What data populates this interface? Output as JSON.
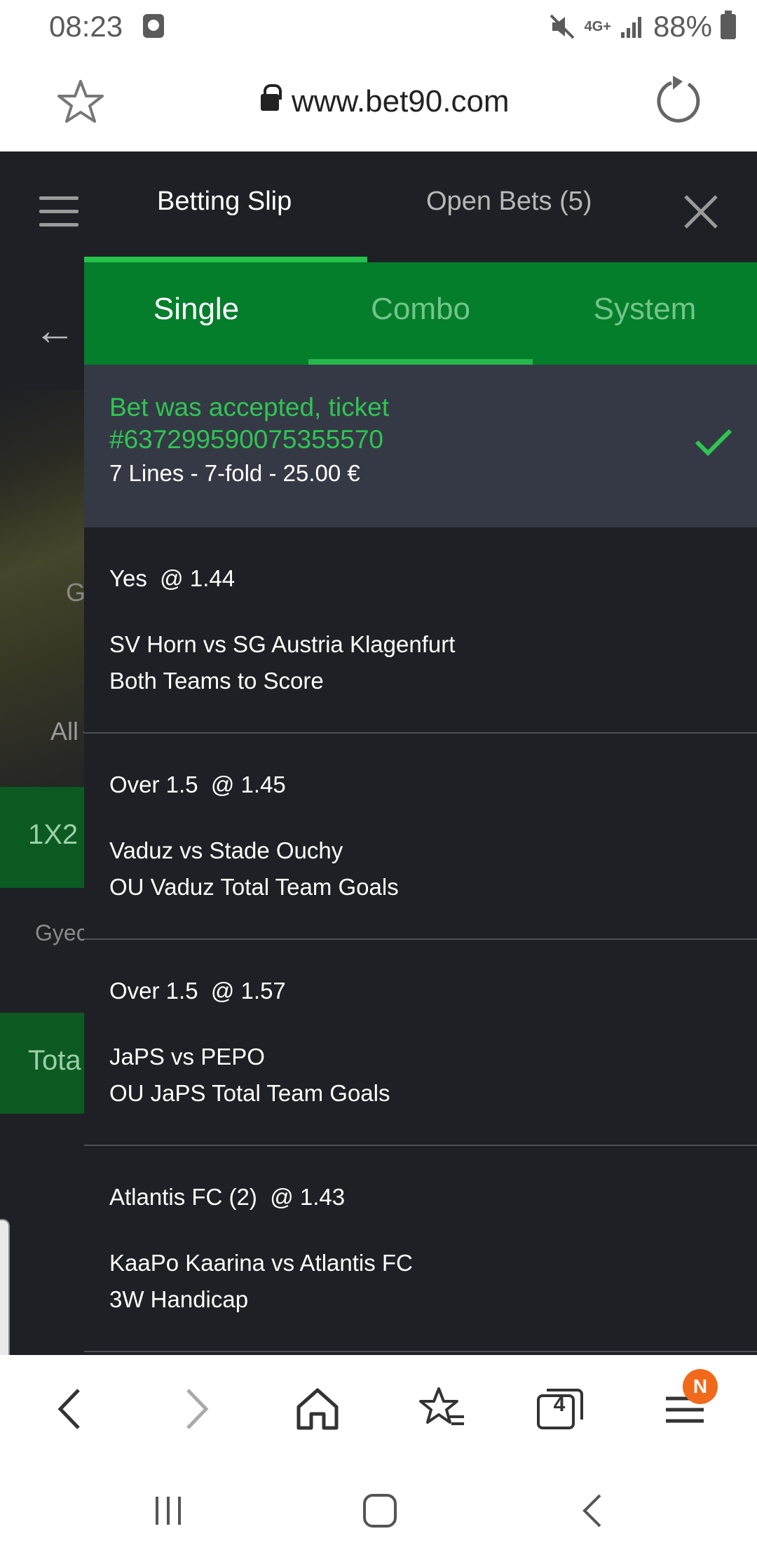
{
  "status_bar": {
    "time": "08:23",
    "network": "4G+",
    "battery": "88%"
  },
  "browser": {
    "url": "www.bet90.com",
    "tab_count": "4",
    "notification_badge": "N"
  },
  "site_background": {
    "label_g": "G",
    "label_all": "All",
    "label_1x2": "1X2",
    "label_gyec": "Gyec",
    "label_tota": "Tota"
  },
  "slip": {
    "tabs": [
      "Betting Slip",
      "Open Bets (5)"
    ],
    "types": [
      "Single",
      "Combo",
      "System"
    ],
    "accepted": {
      "message": "Bet was accepted, ticket #637299590075355570",
      "summary": "7 Lines - 7-fold - 25.00 €"
    },
    "bets": [
      {
        "pick": "Yes  @ 1.44",
        "match": "SV Horn vs SG Austria Klagenfurt",
        "market": "Both Teams to Score"
      },
      {
        "pick": "Over 1.5  @ 1.45",
        "match": "Vaduz vs Stade Ouchy",
        "market": "OU Vaduz Total Team Goals"
      },
      {
        "pick": "Over 1.5  @ 1.57",
        "match": "JaPS vs PEPO",
        "market": "OU JaPS Total Team Goals"
      },
      {
        "pick": "Atlantis FC (2)  @ 1.43",
        "match": "KaaPo Kaarina vs Atlantis FC",
        "market": "3W Handicap"
      }
    ]
  },
  "colors": {
    "accent_green": "#047e2b",
    "success_green": "#2ec552",
    "background": "#1f2025",
    "badge_orange": "#f16a1b"
  }
}
